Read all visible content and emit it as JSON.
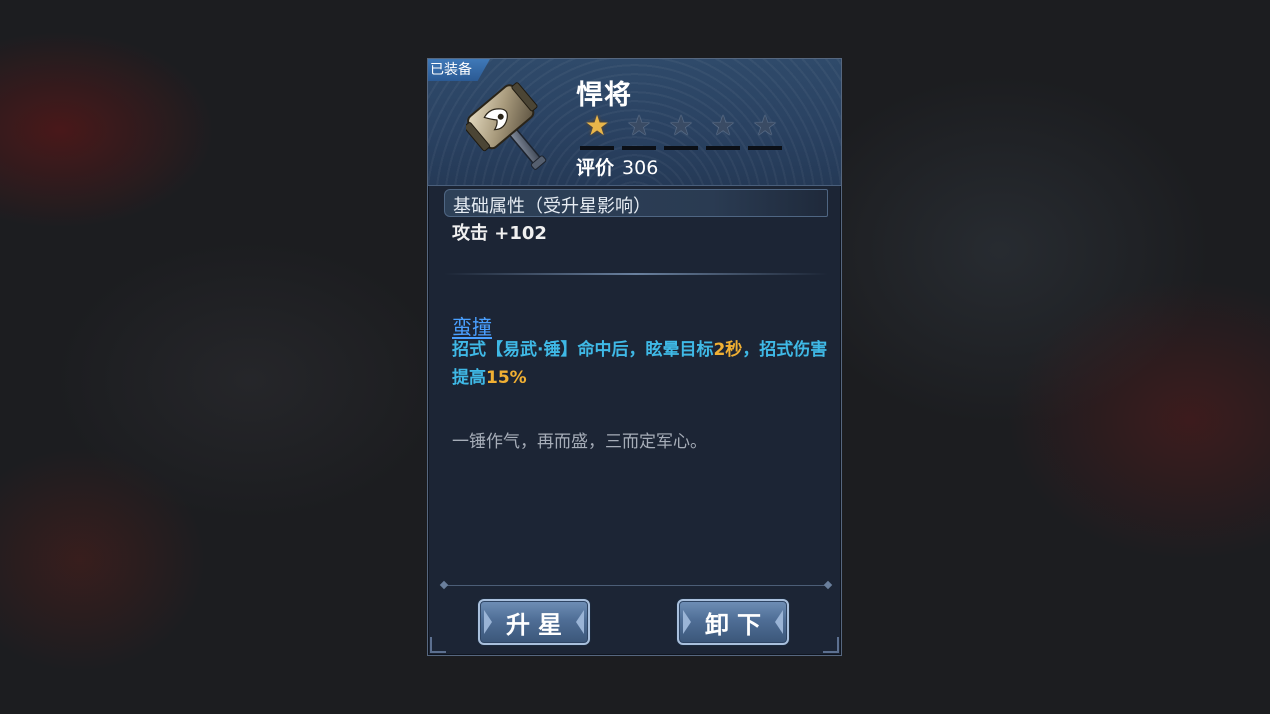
{
  "item": {
    "equipped_tag": "已装备",
    "name": "悍将",
    "stars_filled": 1,
    "stars_total": 5,
    "rating_label": "评价",
    "rating_value": "306"
  },
  "base_attributes": {
    "header": "基础属性（受升星影响）",
    "attack": "攻击 +102"
  },
  "skill": {
    "name": "蛮撞",
    "desc_part1": "招式【易武·锤】命中后，眩晕目标",
    "desc_hl1": "2秒",
    "desc_part2": "，招式伤害提高",
    "desc_hl2": "15%"
  },
  "flavor_text": "一锤作气，再而盛，三而定军心。",
  "buttons": {
    "upgrade": "升星",
    "unequip": "卸下"
  },
  "colors": {
    "star_filled": "#e9b64a",
    "skill_name": "#4aa0ff",
    "skill_desc": "#3fb9e6",
    "highlight": "#f1b033"
  },
  "icons": {
    "weapon": "hammer-icon",
    "star": "star-icon"
  }
}
